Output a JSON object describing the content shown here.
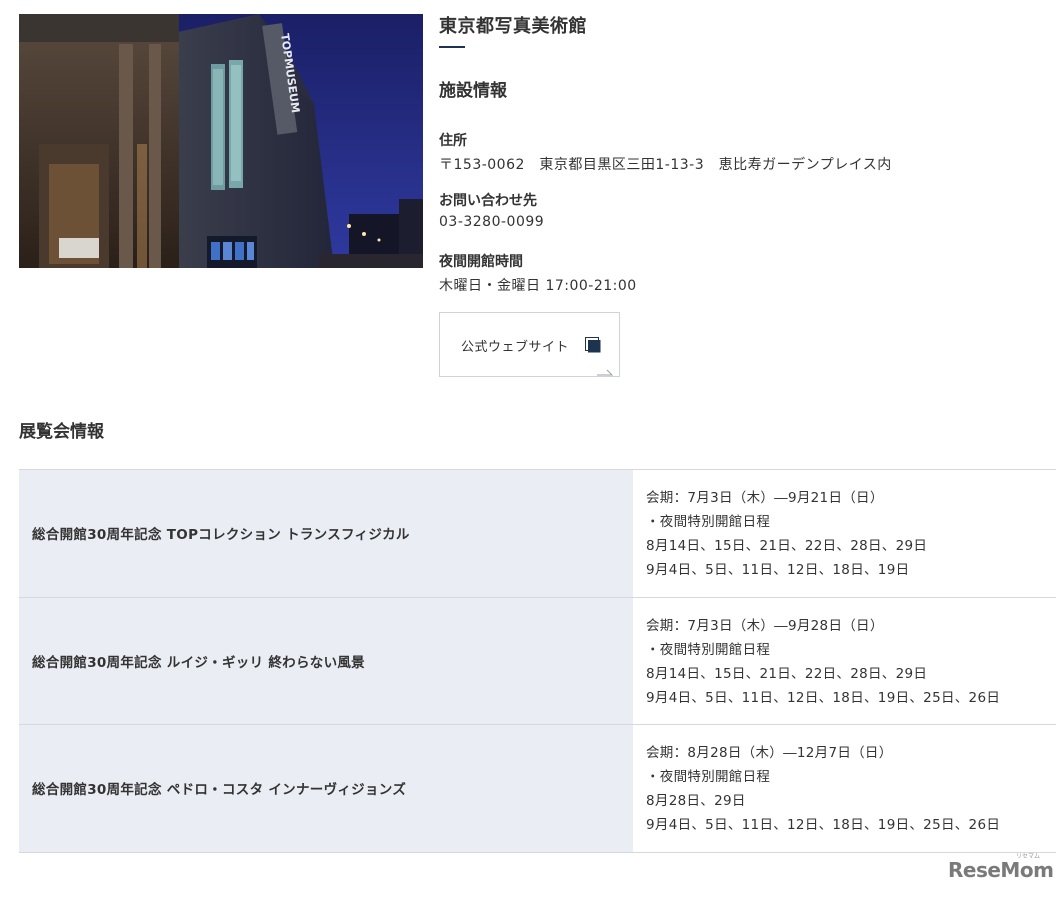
{
  "museum": {
    "name": "東京都写真美術館",
    "facility_heading": "施設情報",
    "address_label": "住所",
    "address_value": "〒153-0062　東京都目黒区三田1-13-3　恵比寿ガーデンプレイス内",
    "contact_label": "お問い合わせ先",
    "contact_value": "03-3280-0099",
    "night_label": "夜間開館時間",
    "night_value": "木曜日・金曜日 17:00-21:00",
    "website_button": "公式ウェブサイト",
    "photo_sign": "TOPMUSEUM"
  },
  "exhibitions": {
    "heading": "展覧会情報",
    "rows": [
      {
        "title": "総合開館30周年記念 TOPコレクション トランスフィジカル",
        "lines": [
          "会期：7月3日（木）―9月21日（日）",
          "・夜間特別開館日程",
          "8月14日、15日、21日、22日、28日、29日",
          "9月4日、5日、11日、12日、18日、19日"
        ]
      },
      {
        "title": "総合開館30周年記念 ルイジ・ギッリ 終わらない風景",
        "lines": [
          "会期：7月3日（木）―9月28日（日）",
          "・夜間特別開館日程",
          "8月14日、15日、21日、22日、28日、29日",
          "9月4日、5日、11日、12日、18日、19日、25日、26日"
        ]
      },
      {
        "title": "総合開館30周年記念 ペドロ・コスタ インナーヴィジョンズ",
        "lines": [
          "会期：8月28日（木）―12月7日（日）",
          "・夜間特別開館日程",
          "8月28日、29日",
          "9月4日、5日、11日、12日、18日、19日、25日、26日"
        ]
      }
    ]
  },
  "logo": {
    "text": "ReseMom",
    "small": "リセマム"
  },
  "colors": {
    "accent": "#1e3350",
    "table_title_bg": "#eaeef4",
    "border": "#d5d8de"
  },
  "icons": {
    "website": "external-window-icon"
  }
}
